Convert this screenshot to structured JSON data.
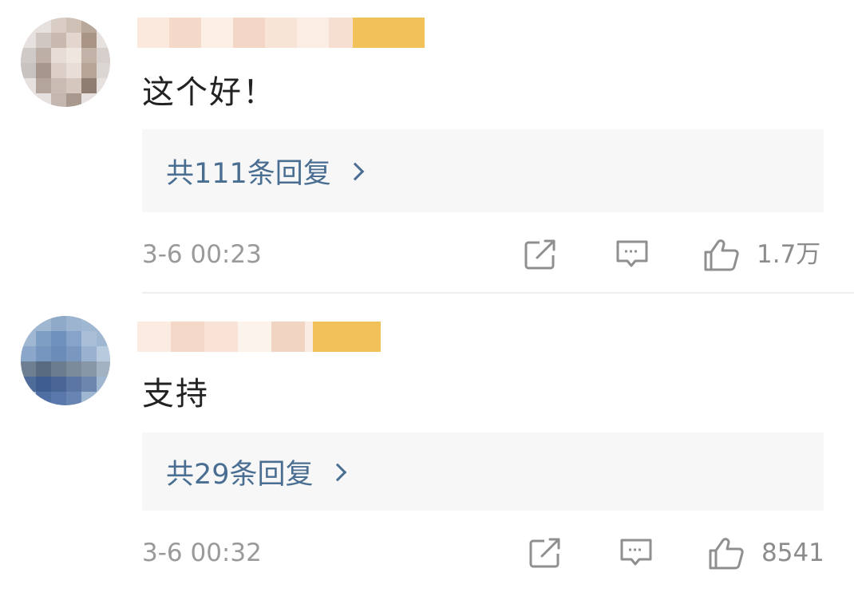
{
  "comments": [
    {
      "text": "这个好！",
      "replies_label": "共111条回复",
      "timestamp": "3-6 00:23",
      "likes": "1.7万"
    },
    {
      "text": "支持",
      "replies_label": "共29条回复",
      "timestamp": "3-6 00:32",
      "likes": "8541"
    }
  ],
  "icons": {
    "share": "share-icon",
    "comment": "comment-icon",
    "like": "thumbs-up-icon",
    "reply_chevron": "chevron-right-icon"
  },
  "colors": {
    "reply_link": "#4a6e92",
    "meta_text": "#9a9a9a",
    "reply_box_bg": "#f7f7f7",
    "badge": "#f1c15a"
  }
}
